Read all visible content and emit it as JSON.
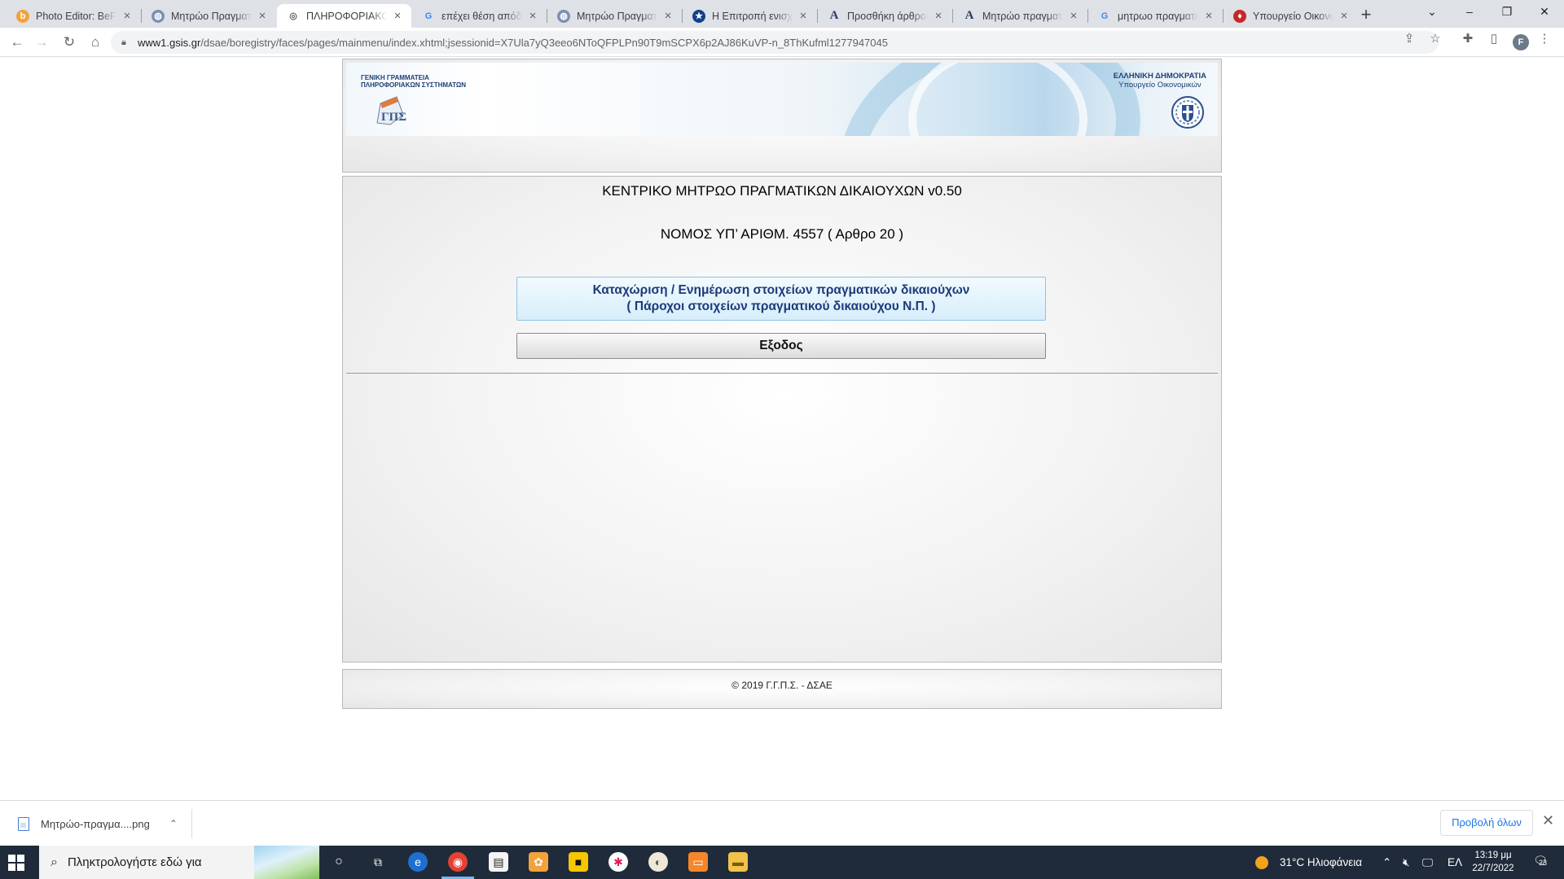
{
  "browser": {
    "tabs": [
      {
        "title": "Photo Editor: BeFunky",
        "favicon": "befunky-icon",
        "color": "#f2a33a",
        "glyph": "b"
      },
      {
        "title": "Μητρώο Πραγματικών",
        "favicon": "globe-app-icon",
        "color": "#7d8fb3",
        "glyph": "◍"
      },
      {
        "title": "ΠΛΗΡΟΦΟΡΙΑΚΟ ΣΥΣΤΗΜΑ",
        "favicon": "globe-icon",
        "color": "#5f6368",
        "glyph": "◎"
      },
      {
        "title": "επέχει θέση απόδειξης",
        "favicon": "google-icon",
        "color": "#4285f4",
        "glyph": "G"
      },
      {
        "title": "Μητρώο Πραγματικών",
        "favicon": "globe-app-icon",
        "color": "#7d8fb3",
        "glyph": "◍"
      },
      {
        "title": "Η Επιτροπή ενισχύει",
        "favicon": "eu-flag-icon",
        "color": "#103f91",
        "glyph": "★"
      },
      {
        "title": "Προσθήκη άρθρου",
        "favicon": "letter-a-icon",
        "color": "#2b3a67",
        "glyph": "A"
      },
      {
        "title": "Μητρώο πραγματικών",
        "favicon": "letter-a-icon",
        "color": "#2b3a67",
        "glyph": "A"
      },
      {
        "title": "μητρωο πραγματικων",
        "favicon": "google-icon",
        "color": "#4285f4",
        "glyph": "G"
      },
      {
        "title": "Υπουργείο Οικονομικών",
        "favicon": "ministry-icon",
        "color": "#c62828",
        "glyph": "♦"
      }
    ],
    "url_host": "www1.gsis.gr",
    "url_path": "/dsae/boregistry/faces/pages/mainmenu/index.xhtml;jsessionid=X7Ula7yQ3eeo6NToQFPLPn90T9mSCPX6p2AJ86KuVP-n_8ThKufml1277947045",
    "profile_initial": "F"
  },
  "header": {
    "gsis_line1": "ΓΕΝΙΚΗ ΓΡΑΜΜΑΤΕΙΑ",
    "gsis_line2": "ΠΛΗΡΟΦΟΡΙΑΚΩΝ ΣΥΣΤΗΜΑΤΩΝ",
    "gsis_logo_text": "ΓΠΣ",
    "republic": "ΕΛΛΗΝΙΚΗ ΔΗΜΟΚΡΑΤΙΑ",
    "ministry": "Υπουργείο Οικονομικών"
  },
  "main": {
    "title": "ΚΕΝΤΡΙΚΟ ΜΗΤΡΩΟ ΠΡΑΓΜΑΤΙΚΩΝ ΔΙΚΑΙΟΥΧΩΝ v0.50",
    "law": "ΝΟΜΟΣ ΥΠ’ ΑΡΙΘΜ. 4557 ( Αρθρο 20 )",
    "register_line1": "Καταχώριση / Ενημέρωση στοιχείων πραγματικών δικαιούχων",
    "register_line2": "( Πάροχοι στοιχείων πραγματικού δικαιούχου Ν.Π. )",
    "exit_label": "Εξοδος"
  },
  "footer": {
    "copyright": "© 2019 Γ.Γ.Π.Σ. - ΔΣΑΕ"
  },
  "downloads": {
    "file_name": "Μητρώο-πραγμα....png",
    "show_all": "Προβολή όλων"
  },
  "taskbar": {
    "search_placeholder": "Πληκτρολογήστε εδώ για",
    "weather": "31°C  Ηλιοφάνεια",
    "language": "ΕΛ",
    "time": "13:19 μμ",
    "date": "22/7/2022",
    "notifications": "23"
  }
}
